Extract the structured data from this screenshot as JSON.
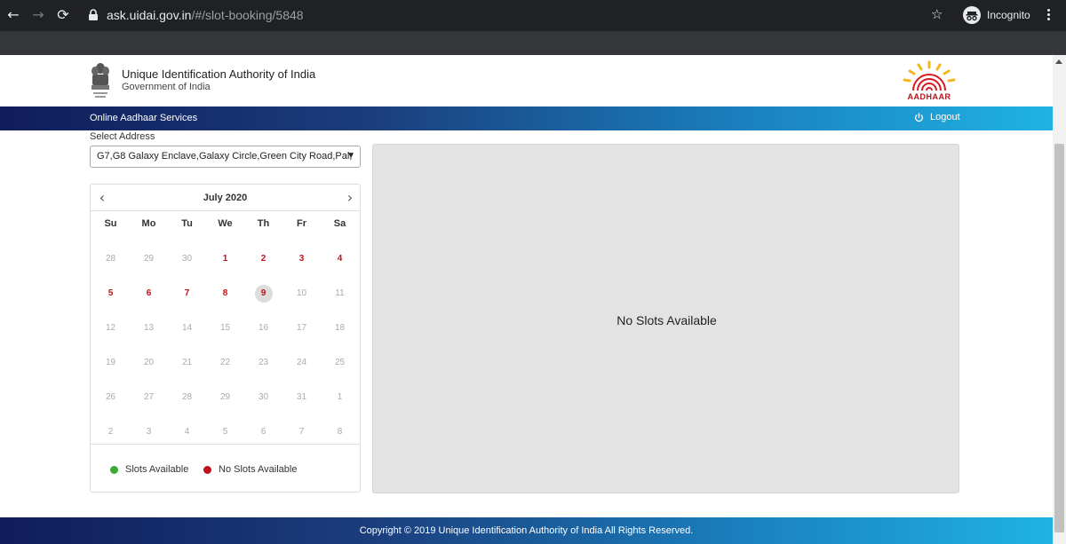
{
  "browser": {
    "url_host": "ask.uidai.gov.in",
    "url_path": "/#/slot-booking/5848",
    "profile_label": "Incognito"
  },
  "header": {
    "org_name": "Unique Identification Authority of India",
    "org_sub": "Government of India",
    "logo_text": "AADHAAR"
  },
  "navbar": {
    "title": "Online Aadhaar Services",
    "logout_label": "Logout"
  },
  "address": {
    "label": "Select Address",
    "selected": "G7,G8 Galaxy Enclave,Galaxy Circle,Green City Road,Pal,"
  },
  "calendar": {
    "month_label": "July 2020",
    "weekdays": [
      "Su",
      "Mo",
      "Tu",
      "We",
      "Th",
      "Fr",
      "Sa"
    ],
    "weeks": [
      [
        "28",
        "29",
        "30",
        "1",
        "2",
        "3",
        "4"
      ],
      [
        "5",
        "6",
        "7",
        "8",
        "9",
        "10",
        "11"
      ],
      [
        "12",
        "13",
        "14",
        "15",
        "16",
        "17",
        "18"
      ],
      [
        "19",
        "20",
        "21",
        "22",
        "23",
        "24",
        "25"
      ],
      [
        "26",
        "27",
        "28",
        "29",
        "30",
        "31",
        "1"
      ],
      [
        "2",
        "3",
        "4",
        "5",
        "6",
        "7",
        "8"
      ]
    ],
    "no_slot_days": [
      "1",
      "2",
      "3",
      "4",
      "5",
      "6",
      "7",
      "8"
    ],
    "selected_day": "9",
    "legend": {
      "available": "Slots Available",
      "not_available": "No Slots Available"
    }
  },
  "slots": {
    "message": "No Slots Available"
  },
  "footer": {
    "copyright": "Copyright © 2019 Unique Identification Authority of India All Rights Reserved."
  },
  "colors": {
    "available": "#3aa935",
    "not_available": "#c0121b",
    "nav_start": "#101c5a",
    "nav_end": "#1fb3e3"
  }
}
